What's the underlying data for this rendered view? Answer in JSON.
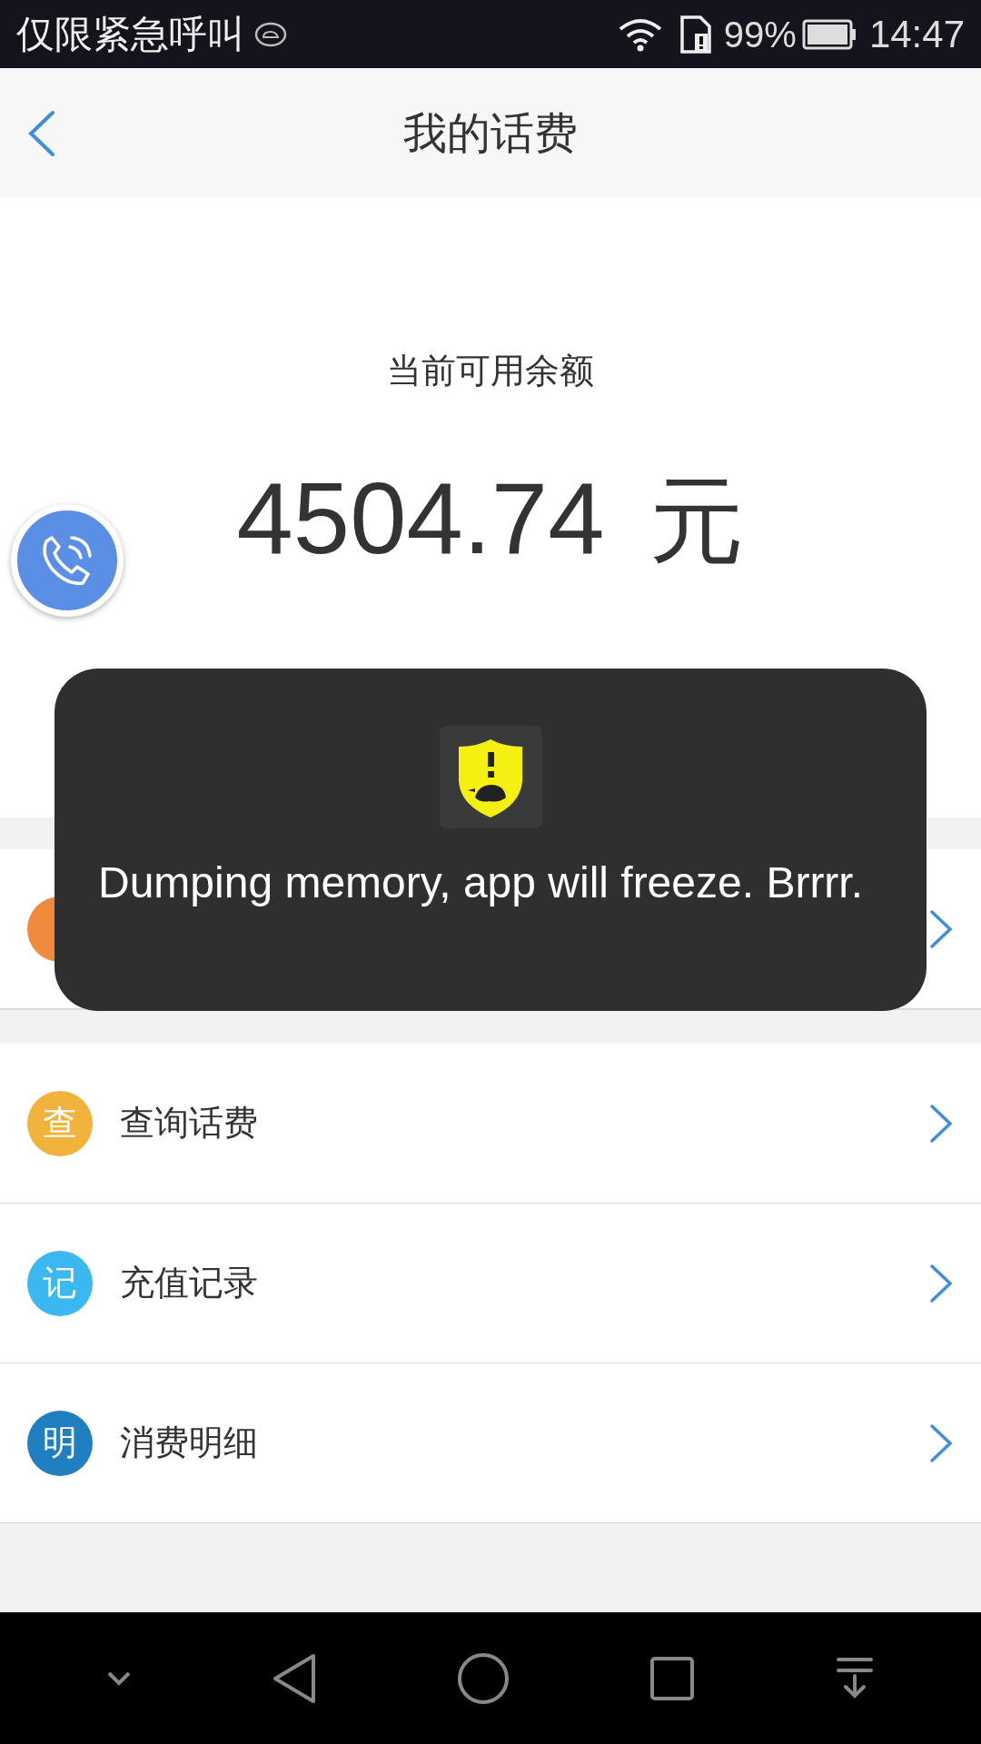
{
  "status_bar": {
    "carrier": "仅限紧急呼叫",
    "battery": "99%",
    "time": "14:47"
  },
  "header": {
    "title": "我的话费"
  },
  "balance": {
    "label": "当前可用余额",
    "amount": "4504.74",
    "unit": "元"
  },
  "menu": [
    {
      "color": "#f08a3c"
    },
    {
      "icon": "查",
      "label": "查询话费",
      "color": "#f2b33d"
    },
    {
      "icon": "记",
      "label": "充值记录",
      "color": "#3ab8ef"
    },
    {
      "icon": "明",
      "label": "消费明细",
      "color": "#1f7fc0"
    }
  ],
  "toast": {
    "message": "Dumping memory, app will freeze. Brrrr."
  }
}
